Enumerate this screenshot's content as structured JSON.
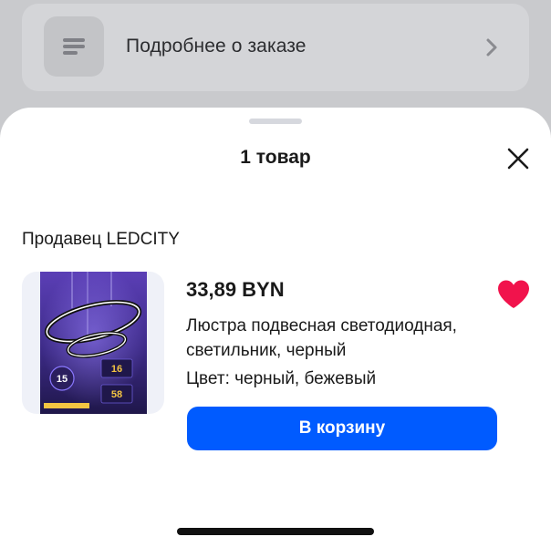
{
  "background": {
    "order_details_label": "Подробнее о заказе",
    "list_icon": "list-icon",
    "chevron_icon": "chevron-right-icon"
  },
  "sheet": {
    "title": "1 товар",
    "close_icon": "close-icon",
    "seller_label": "Продавец LEDCITY",
    "product": {
      "price": "33,89 BYN",
      "name": "Люстра подвесная светодиодная, светильник, черный",
      "color": "Цвет: черный, бежевый",
      "favorite_icon": "heart-icon",
      "favorite": true,
      "image": {
        "badge_left": "15",
        "badge_top": "16",
        "badge_bottom": "58"
      }
    },
    "add_to_cart_label": "В корзину"
  },
  "colors": {
    "accent": "#005bff",
    "favorite": "#f1134c",
    "sheet_bg": "#ffffff",
    "dim_bg": "#c9cacd"
  }
}
